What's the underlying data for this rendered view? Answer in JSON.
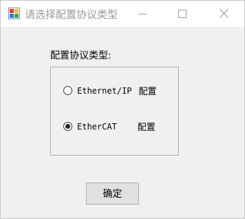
{
  "window": {
    "title": "请选择配置协议类型",
    "app_icon": "app-icon",
    "controls": {
      "minimize_icon": "minimize-icon",
      "maximize_icon": "maximize-icon",
      "close_icon": "close-icon"
    }
  },
  "group": {
    "label": "配置协议类型:",
    "options": [
      {
        "label": "Ethernet/IP",
        "suffix": "配置",
        "checked": false
      },
      {
        "label": "EtherCAT",
        "suffix": "配置",
        "checked": true
      }
    ]
  },
  "buttons": {
    "ok_label": "确定"
  },
  "colors": {
    "background": "#f0f0f0",
    "titlebar": "#ffffff",
    "title_text": "#999999",
    "button_face": "#e1e1e1",
    "button_border": "#adadad",
    "group_border": "#a0a0a0"
  }
}
